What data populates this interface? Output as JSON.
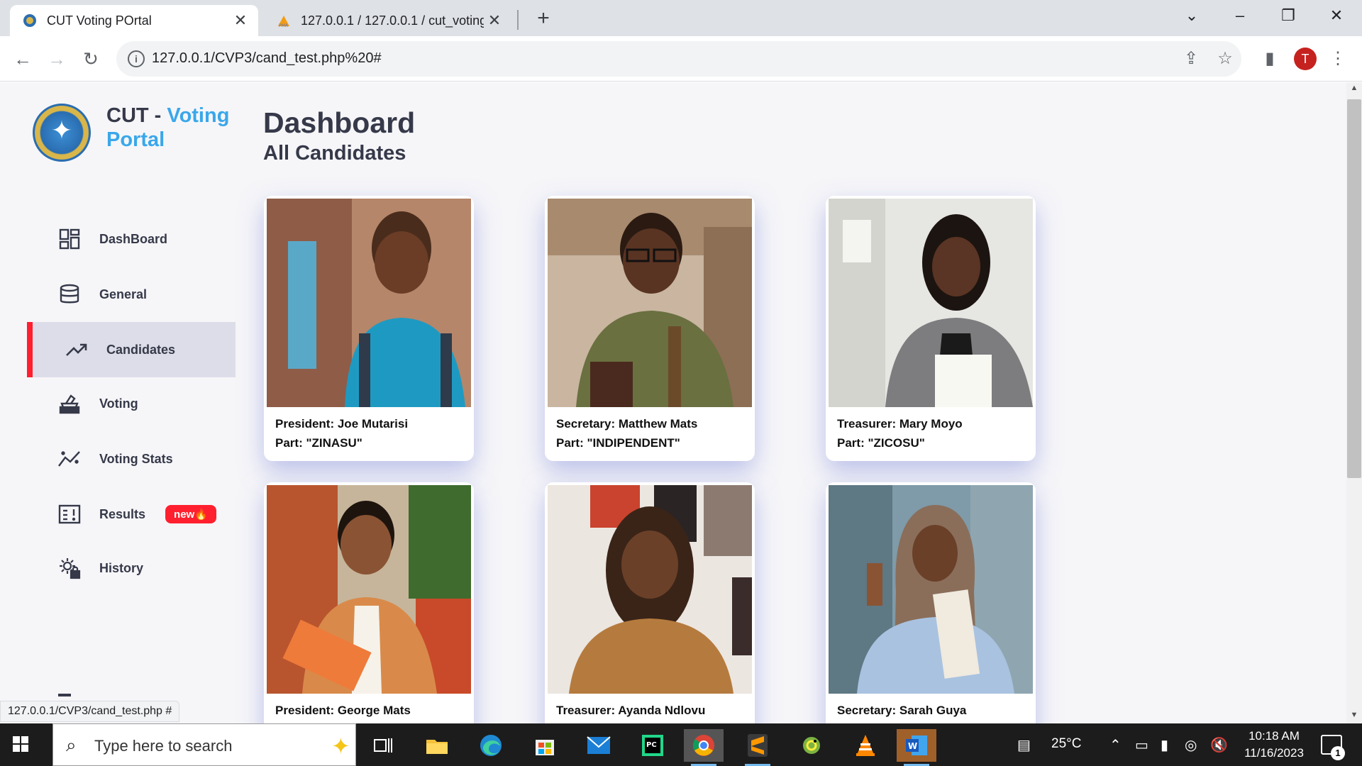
{
  "browser": {
    "tabs": [
      {
        "title": "CUT Voting POrtal"
      },
      {
        "title": "127.0.0.1 / 127.0.0.1 / cut_voting"
      }
    ],
    "url": "127.0.0.1/CVP3/cand_test.php%20#",
    "profile_initial": "T",
    "status_url": "127.0.0.1/CVP3/cand_test.php #"
  },
  "brand": {
    "prefix": "CUT - ",
    "line1_accent": "Voting",
    "line2_accent": "Portal"
  },
  "sidebar": {
    "items": [
      {
        "label": "DashBoard",
        "icon": "dashboard-grid-icon"
      },
      {
        "label": "General",
        "icon": "database-icon"
      },
      {
        "label": "Candidates",
        "icon": "trending-up-icon",
        "active": true
      },
      {
        "label": "Voting",
        "icon": "ballot-box-icon"
      },
      {
        "label": "Voting Stats",
        "icon": "stats-line-icon"
      },
      {
        "label": "Results",
        "icon": "results-report-icon",
        "badge": "new🔥"
      },
      {
        "label": "History",
        "icon": "history-gear-icon"
      }
    ],
    "active_color": "#ff1f2e",
    "accent_color": "#3aa7ea"
  },
  "main": {
    "title": "Dashboard",
    "subtitle": "All Candidates"
  },
  "candidates": [
    {
      "role_line": "President: Joe Mutarisi",
      "party_line": "Part: \"ZINASU\""
    },
    {
      "role_line": "Secretary: Matthew Mats",
      "party_line": "Part: \"INDIPENDENT\""
    },
    {
      "role_line": "Treasurer: Mary Moyo",
      "party_line": "Part: \"ZICOSU\""
    },
    {
      "role_line": "President: George Mats",
      "party_line": ""
    },
    {
      "role_line": "Treasurer: Ayanda Ndlovu",
      "party_line": ""
    },
    {
      "role_line": "Secretary: Sarah Guya",
      "party_line": ""
    }
  ],
  "taskbar": {
    "search_placeholder": "Type here to search",
    "weather": "25°C",
    "time": "10:18 AM",
    "date": "11/16/2023",
    "notifications": "1"
  }
}
